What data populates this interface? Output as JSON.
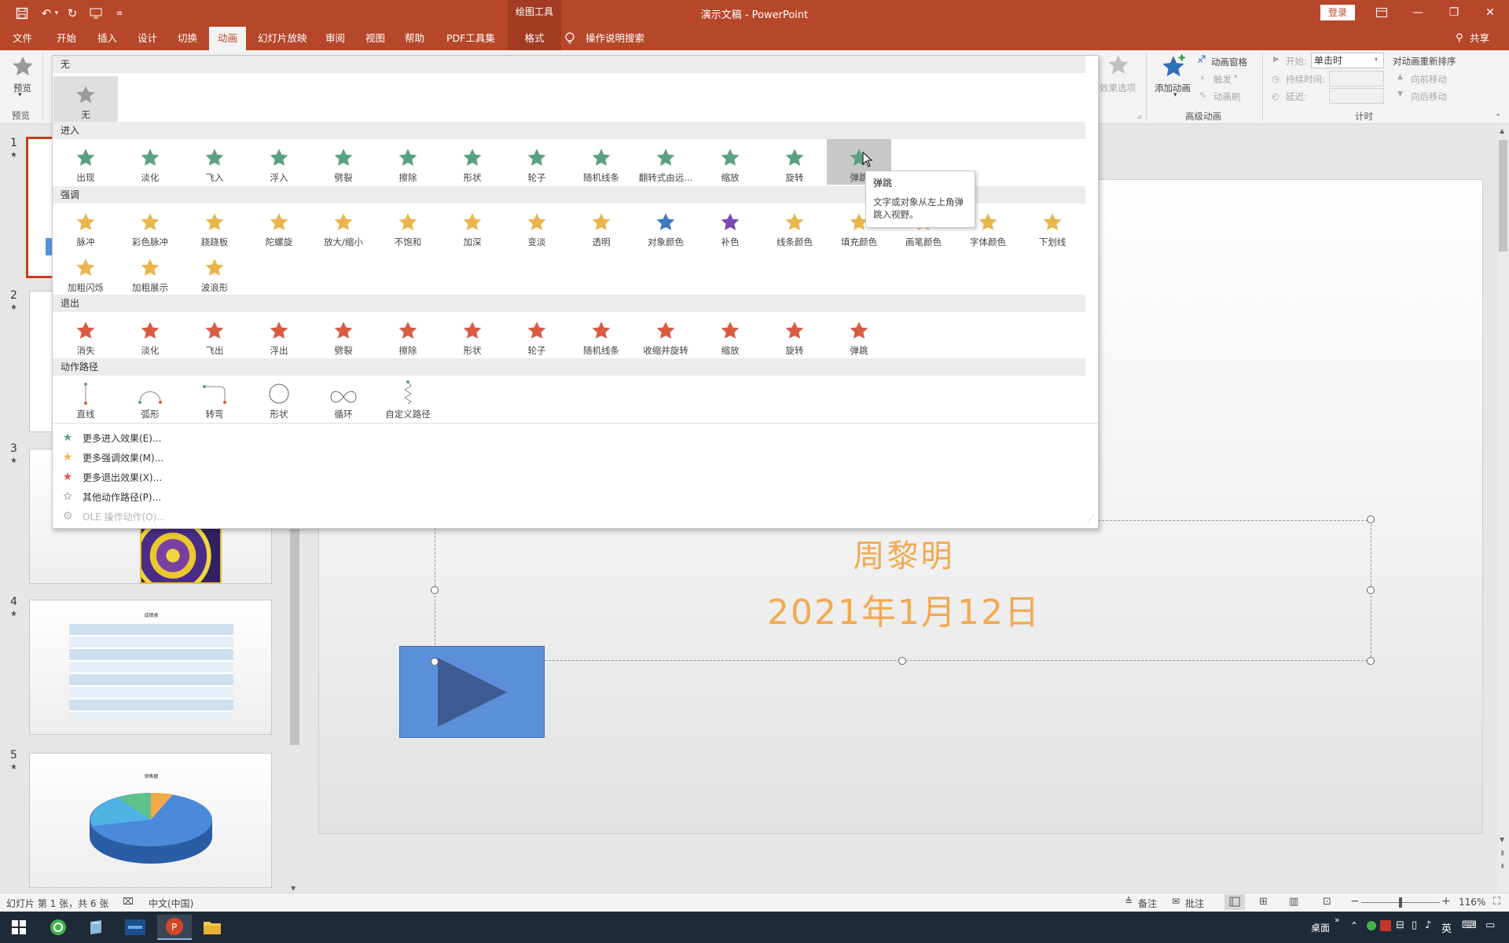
{
  "window": {
    "title": "演示文稿 - PowerPoint",
    "context_tool": "绘图工具",
    "login": "登录",
    "share": "共享",
    "tell_me": "操作说明搜索"
  },
  "tabs": [
    "文件",
    "开始",
    "插入",
    "设计",
    "切换",
    "动画",
    "幻灯片放映",
    "审阅",
    "视图",
    "帮助",
    "PDF工具集",
    "格式"
  ],
  "active_tab": "动画",
  "ribbon": {
    "preview_label": "预览",
    "preview_group": "预览",
    "effect_options": "效果选项",
    "add_animation": "添加动画",
    "animation_pane": "动画窗格",
    "trigger": "触发",
    "animation_painter": "动画刷",
    "advanced_group": "高级动画",
    "start_label": "开始:",
    "start_value": "单击时",
    "duration_label": "持续时间:",
    "delay_label": "延迟:",
    "reorder_title": "对动画重新排序",
    "move_earlier": "向前移动",
    "move_later": "向后移动",
    "timing_group": "计时"
  },
  "gallery": {
    "none_header": "无",
    "none_item": "无",
    "entrance_header": "进入",
    "entrance": [
      "出现",
      "淡化",
      "飞入",
      "浮入",
      "劈裂",
      "擦除",
      "形状",
      "轮子",
      "随机线条",
      "翻转式由远...",
      "缩放",
      "旋转",
      "弹跳"
    ],
    "emphasis_header": "强调",
    "emphasis": [
      "脉冲",
      "彩色脉冲",
      "跷跷板",
      "陀螺旋",
      "放大/缩小",
      "不饱和",
      "加深",
      "变淡",
      "透明",
      "对象颜色",
      "补色",
      "线条颜色",
      "填充颜色",
      "画笔颜色",
      "字体颜色",
      "下划线",
      "加粗闪烁",
      "加粗展示",
      "波浪形"
    ],
    "exit_header": "退出",
    "exit": [
      "消失",
      "淡化",
      "飞出",
      "浮出",
      "劈裂",
      "擦除",
      "形状",
      "轮子",
      "随机线条",
      "收缩并旋转",
      "缩放",
      "旋转",
      "弹跳"
    ],
    "path_header": "动作路径",
    "paths": [
      "直线",
      "弧形",
      "转弯",
      "形状",
      "循环",
      "自定义路径"
    ],
    "more": [
      "更多进入效果(E)...",
      "更多强调效果(M)...",
      "更多退出效果(X)...",
      "其他动作路径(P)...",
      "OLE 操作动作(O)..."
    ],
    "colors": {
      "entrance": "#5aa17f",
      "emphasis": "#e9b54d",
      "exit": "#d95b43"
    }
  },
  "tooltip": {
    "title": "弹跳",
    "body": "文字或对象从左上角弹跳入视野。"
  },
  "slide": {
    "name": "周黎明",
    "date": "2021年1月12日"
  },
  "thumbs": {
    "slide4_title": "成绩表",
    "slide5_title": "销售额"
  },
  "status": {
    "slide_info": "幻灯片 第 1 张，共 6 张",
    "language": "中文(中国)",
    "notes": "备注",
    "comments": "批注",
    "zoom": "116%"
  },
  "taskbar": {
    "desktop": "桌面",
    "ime": "英"
  }
}
